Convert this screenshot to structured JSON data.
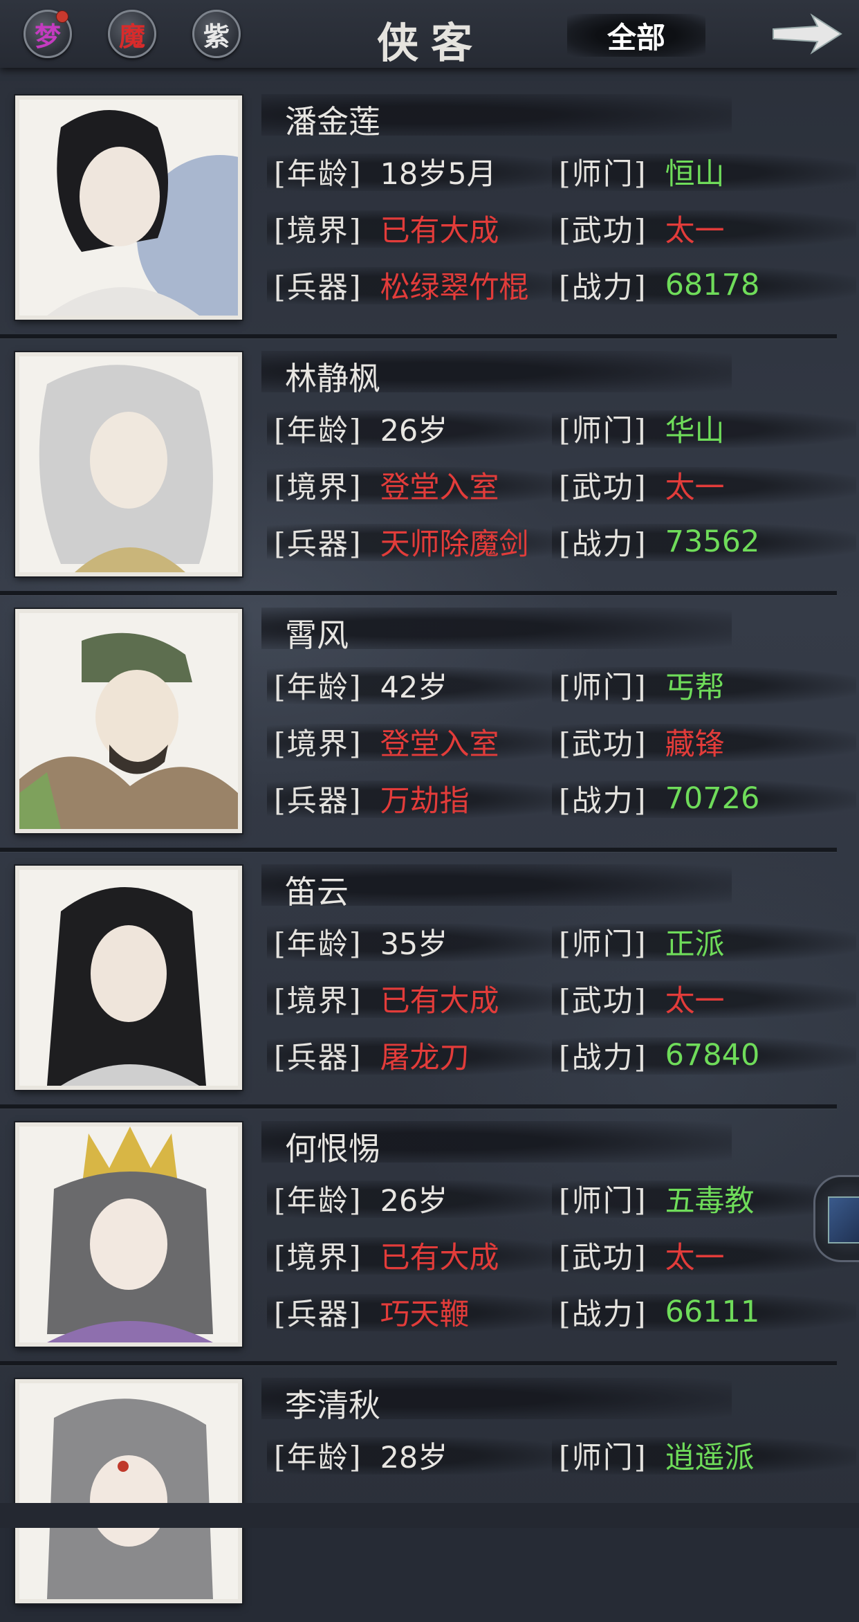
{
  "header": {
    "buttons": [
      {
        "glyph": "梦",
        "color": "#c43bc0",
        "badge": true
      },
      {
        "glyph": "魔",
        "color": "#d82b2b",
        "badge": false
      },
      {
        "glyph": "紫",
        "color": "#e8e8e8",
        "badge": false
      }
    ],
    "title": "侠客",
    "filter_label": "全部",
    "arrow_icon": "arrow-right-icon"
  },
  "labels": {
    "age": "[年龄]",
    "school": "[师门]",
    "realm": "[境界]",
    "martial": "[武功]",
    "weapon": "[兵器]",
    "power": "[战力]"
  },
  "colors": {
    "value_red": "#e23c3a",
    "value_green": "#6fdc5a",
    "text_white": "#e8e6e2"
  },
  "heroes": [
    {
      "name": "潘金莲",
      "age": "18岁5月",
      "school": "恒山",
      "realm": "已有大成",
      "martial": "太一",
      "weapon": "松绿翠竹棍",
      "power": "68178"
    },
    {
      "name": "林静枫",
      "age": "26岁",
      "school": "华山",
      "realm": "登堂入室",
      "martial": "太一",
      "weapon": "天师除魔剑",
      "power": "73562"
    },
    {
      "name": "霄风",
      "age": "42岁",
      "school": "丐帮",
      "realm": "登堂入室",
      "martial": "藏锋",
      "weapon": "万劫指",
      "power": "70726"
    },
    {
      "name": "笛云",
      "age": "35岁",
      "school": "正派",
      "realm": "已有大成",
      "martial": "太一",
      "weapon": "屠龙刀",
      "power": "67840"
    },
    {
      "name": "何恨惕",
      "age": "26岁",
      "school": "五毒教",
      "realm": "已有大成",
      "martial": "太一",
      "weapon": "巧天鞭",
      "power": "66111"
    },
    {
      "name": "李清秋",
      "age": "28岁",
      "school": "逍遥派",
      "realm": "",
      "martial": "",
      "weapon": "",
      "power": ""
    }
  ]
}
